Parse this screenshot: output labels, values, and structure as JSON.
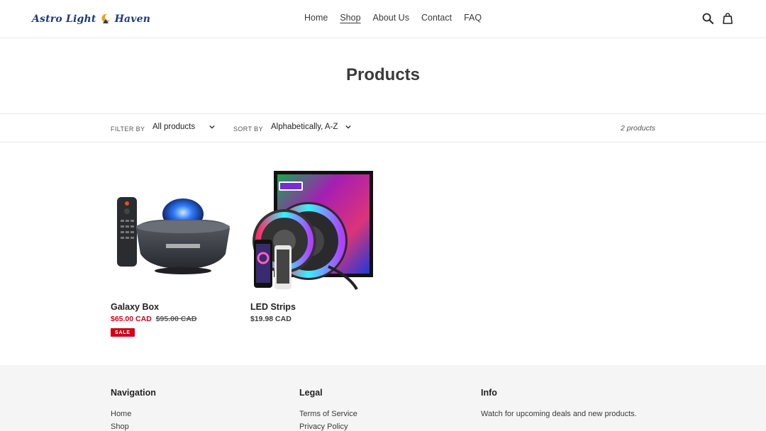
{
  "header": {
    "logo_part1": "Astro Light",
    "logo_part2": "Haven",
    "nav": [
      "Home",
      "Shop",
      "About Us",
      "Contact",
      "FAQ"
    ],
    "active_nav": "Shop",
    "icons": [
      "search-icon",
      "cart-icon"
    ]
  },
  "page": {
    "title": "Products"
  },
  "filters": {
    "filter_label": "Filter by",
    "filter_value": "All products",
    "sort_label": "Sort by",
    "sort_value": "Alphabetically, A-Z",
    "count": "2 products"
  },
  "products": [
    {
      "name": "Galaxy Box",
      "sale_price": "$65.00 CAD",
      "compare_price": "$95.00 CAD",
      "badge": "SALE"
    },
    {
      "name": "LED Strips",
      "price": "$19.98 CAD"
    }
  ],
  "footer": {
    "navigation": {
      "title": "Navigation",
      "links": [
        "Home",
        "Shop"
      ]
    },
    "legal": {
      "title": "Legal",
      "links": [
        "Terms of Service",
        "Privacy Policy"
      ]
    },
    "info": {
      "title": "Info",
      "text": "Watch for upcoming deals and new products."
    }
  },
  "colors": {
    "sale": "#d0021b",
    "logo": "#1f3a7a",
    "footer_bg": "#f5f5f5",
    "logo_accent": "#f0a020"
  }
}
